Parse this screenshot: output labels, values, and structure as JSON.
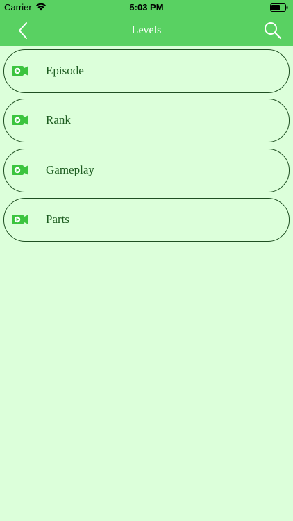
{
  "status_bar": {
    "carrier": "Carrier",
    "time": "5:03 PM"
  },
  "nav": {
    "title": "Levels"
  },
  "icons": {
    "back": "chevron-left-icon",
    "search": "search-icon",
    "item": "video-camera-icon"
  },
  "colors": {
    "header": "#59d162",
    "background": "#dcffda",
    "item_text": "#1d5c20",
    "item_border": "#1f4f22",
    "icon": "#3cc43f"
  },
  "list": {
    "items": [
      {
        "label": "Episode"
      },
      {
        "label": "Rank"
      },
      {
        "label": "Gameplay"
      },
      {
        "label": "Parts"
      }
    ]
  }
}
